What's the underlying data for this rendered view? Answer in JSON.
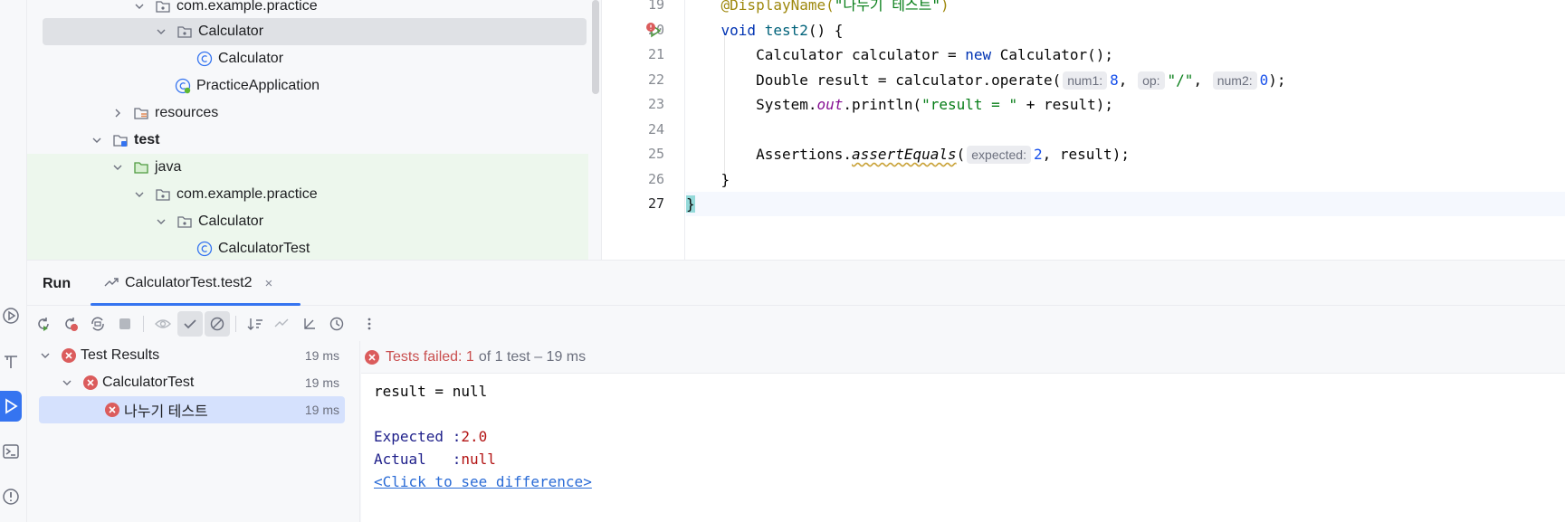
{
  "project_tree": {
    "rows": [
      {
        "label": "com.example.practice",
        "icon": "package-icon",
        "chevron": "down"
      },
      {
        "label": "Calculator",
        "icon": "package-icon",
        "chevron": "down"
      },
      {
        "label": "Calculator",
        "icon": "class-icon",
        "chevron": ""
      },
      {
        "label": "PracticeApplication",
        "icon": "spring-class-icon",
        "chevron": ""
      },
      {
        "label": "resources",
        "icon": "resources-folder-icon",
        "chevron": "right"
      },
      {
        "label": "test",
        "icon": "test-module-folder-icon",
        "chevron": "down"
      },
      {
        "label": "java",
        "icon": "test-sources-folder-icon",
        "chevron": "down"
      },
      {
        "label": "com.example.practice",
        "icon": "package-icon",
        "chevron": "down"
      },
      {
        "label": "Calculator",
        "icon": "package-icon",
        "chevron": "down"
      },
      {
        "label": "CalculatorTest",
        "icon": "class-icon",
        "chevron": ""
      }
    ]
  },
  "editor": {
    "line_numbers": [
      "19",
      "20",
      "21",
      "22",
      "23",
      "24",
      "25",
      "26",
      "27"
    ],
    "lines": {
      "l19_ann": "@DisplayName(",
      "l19_str": "\"나누기 테스트\"",
      "l19_end": ")",
      "l20_kw": "void",
      "l20_name": "test2",
      "l20_rest": "() {",
      "l21_a": "Calculator calculator = ",
      "l21_kw": "new",
      "l21_b": " Calculator();",
      "l22_a": "Double result = calculator.operate(",
      "l22_hint1": "num1:",
      "l22_num1": "8",
      "l22_sep1": ",",
      "l22_hint2": "op:",
      "l22_str": "\"/\"",
      "l22_sep2": ",",
      "l22_hint3": "num2:",
      "l22_num2": "0",
      "l22_end": ");",
      "l23_a": "System.",
      "l23_out": "out",
      "l23_b": ".println(",
      "l23_str": "\"result = \"",
      "l23_c": " + result);",
      "l25_a": "Assertions.",
      "l25_method": "assertEquals",
      "l25_b": "(",
      "l25_hint": "expected:",
      "l25_num": "2",
      "l25_c": ", result);",
      "l26": "}",
      "l27": "}"
    }
  },
  "run_panel": {
    "title": "Run",
    "tab_label": "CalculatorTest.test2",
    "tab_close": "×",
    "results": [
      {
        "label": "Test Results",
        "time": "19 ms"
      },
      {
        "label": "CalculatorTest",
        "time": "19 ms"
      },
      {
        "label": "나누기 테스트",
        "time": "19 ms"
      }
    ],
    "status": {
      "failed_text": "Tests failed: 1",
      "rest_text": "of 1 test – 19 ms"
    },
    "console": {
      "line1": "result = null",
      "expected_label": "Expected :",
      "expected_value": "2.0",
      "actual_label": "Actual   :",
      "actual_value": "null",
      "diff_link": "<Click to see difference>"
    }
  },
  "colors": {
    "accent": "#3574f0",
    "error": "#db5c5c",
    "test_source_bg": "#edf7ed"
  }
}
